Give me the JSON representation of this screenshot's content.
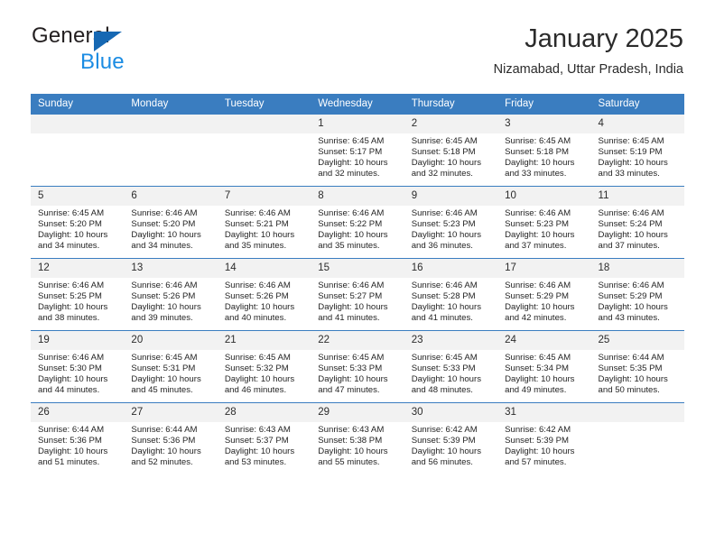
{
  "brand": {
    "name_part1": "General",
    "name_part2": "Blue",
    "logo_icon": "triangle-flag-icon",
    "accent_color": "#1668b3",
    "secondary_color": "#1b8ce3"
  },
  "header": {
    "title": "January 2025",
    "subtitle": "Nizamabad, Uttar Pradesh, India"
  },
  "theme": {
    "header_bar_color": "#3a7dc0",
    "day_number_bg": "#f2f2f2",
    "grid_line_color": "#3a7dc0"
  },
  "weekday_headers": [
    "Sunday",
    "Monday",
    "Tuesday",
    "Wednesday",
    "Thursday",
    "Friday",
    "Saturday"
  ],
  "weeks": [
    [
      {
        "day": "",
        "empty": true,
        "sunrise": "",
        "sunset": "",
        "daylight_line1": "",
        "daylight_line2": ""
      },
      {
        "day": "",
        "empty": true,
        "sunrise": "",
        "sunset": "",
        "daylight_line1": "",
        "daylight_line2": ""
      },
      {
        "day": "",
        "empty": true,
        "sunrise": "",
        "sunset": "",
        "daylight_line1": "",
        "daylight_line2": ""
      },
      {
        "day": "1",
        "sunrise": "Sunrise: 6:45 AM",
        "sunset": "Sunset: 5:17 PM",
        "daylight_line1": "Daylight: 10 hours",
        "daylight_line2": "and 32 minutes."
      },
      {
        "day": "2",
        "sunrise": "Sunrise: 6:45 AM",
        "sunset": "Sunset: 5:18 PM",
        "daylight_line1": "Daylight: 10 hours",
        "daylight_line2": "and 32 minutes."
      },
      {
        "day": "3",
        "sunrise": "Sunrise: 6:45 AM",
        "sunset": "Sunset: 5:18 PM",
        "daylight_line1": "Daylight: 10 hours",
        "daylight_line2": "and 33 minutes."
      },
      {
        "day": "4",
        "sunrise": "Sunrise: 6:45 AM",
        "sunset": "Sunset: 5:19 PM",
        "daylight_line1": "Daylight: 10 hours",
        "daylight_line2": "and 33 minutes."
      }
    ],
    [
      {
        "day": "5",
        "sunrise": "Sunrise: 6:45 AM",
        "sunset": "Sunset: 5:20 PM",
        "daylight_line1": "Daylight: 10 hours",
        "daylight_line2": "and 34 minutes."
      },
      {
        "day": "6",
        "sunrise": "Sunrise: 6:46 AM",
        "sunset": "Sunset: 5:20 PM",
        "daylight_line1": "Daylight: 10 hours",
        "daylight_line2": "and 34 minutes."
      },
      {
        "day": "7",
        "sunrise": "Sunrise: 6:46 AM",
        "sunset": "Sunset: 5:21 PM",
        "daylight_line1": "Daylight: 10 hours",
        "daylight_line2": "and 35 minutes."
      },
      {
        "day": "8",
        "sunrise": "Sunrise: 6:46 AM",
        "sunset": "Sunset: 5:22 PM",
        "daylight_line1": "Daylight: 10 hours",
        "daylight_line2": "and 35 minutes."
      },
      {
        "day": "9",
        "sunrise": "Sunrise: 6:46 AM",
        "sunset": "Sunset: 5:23 PM",
        "daylight_line1": "Daylight: 10 hours",
        "daylight_line2": "and 36 minutes."
      },
      {
        "day": "10",
        "sunrise": "Sunrise: 6:46 AM",
        "sunset": "Sunset: 5:23 PM",
        "daylight_line1": "Daylight: 10 hours",
        "daylight_line2": "and 37 minutes."
      },
      {
        "day": "11",
        "sunrise": "Sunrise: 6:46 AM",
        "sunset": "Sunset: 5:24 PM",
        "daylight_line1": "Daylight: 10 hours",
        "daylight_line2": "and 37 minutes."
      }
    ],
    [
      {
        "day": "12",
        "sunrise": "Sunrise: 6:46 AM",
        "sunset": "Sunset: 5:25 PM",
        "daylight_line1": "Daylight: 10 hours",
        "daylight_line2": "and 38 minutes."
      },
      {
        "day": "13",
        "sunrise": "Sunrise: 6:46 AM",
        "sunset": "Sunset: 5:26 PM",
        "daylight_line1": "Daylight: 10 hours",
        "daylight_line2": "and 39 minutes."
      },
      {
        "day": "14",
        "sunrise": "Sunrise: 6:46 AM",
        "sunset": "Sunset: 5:26 PM",
        "daylight_line1": "Daylight: 10 hours",
        "daylight_line2": "and 40 minutes."
      },
      {
        "day": "15",
        "sunrise": "Sunrise: 6:46 AM",
        "sunset": "Sunset: 5:27 PM",
        "daylight_line1": "Daylight: 10 hours",
        "daylight_line2": "and 41 minutes."
      },
      {
        "day": "16",
        "sunrise": "Sunrise: 6:46 AM",
        "sunset": "Sunset: 5:28 PM",
        "daylight_line1": "Daylight: 10 hours",
        "daylight_line2": "and 41 minutes."
      },
      {
        "day": "17",
        "sunrise": "Sunrise: 6:46 AM",
        "sunset": "Sunset: 5:29 PM",
        "daylight_line1": "Daylight: 10 hours",
        "daylight_line2": "and 42 minutes."
      },
      {
        "day": "18",
        "sunrise": "Sunrise: 6:46 AM",
        "sunset": "Sunset: 5:29 PM",
        "daylight_line1": "Daylight: 10 hours",
        "daylight_line2": "and 43 minutes."
      }
    ],
    [
      {
        "day": "19",
        "sunrise": "Sunrise: 6:46 AM",
        "sunset": "Sunset: 5:30 PM",
        "daylight_line1": "Daylight: 10 hours",
        "daylight_line2": "and 44 minutes."
      },
      {
        "day": "20",
        "sunrise": "Sunrise: 6:45 AM",
        "sunset": "Sunset: 5:31 PM",
        "daylight_line1": "Daylight: 10 hours",
        "daylight_line2": "and 45 minutes."
      },
      {
        "day": "21",
        "sunrise": "Sunrise: 6:45 AM",
        "sunset": "Sunset: 5:32 PM",
        "daylight_line1": "Daylight: 10 hours",
        "daylight_line2": "and 46 minutes."
      },
      {
        "day": "22",
        "sunrise": "Sunrise: 6:45 AM",
        "sunset": "Sunset: 5:33 PM",
        "daylight_line1": "Daylight: 10 hours",
        "daylight_line2": "and 47 minutes."
      },
      {
        "day": "23",
        "sunrise": "Sunrise: 6:45 AM",
        "sunset": "Sunset: 5:33 PM",
        "daylight_line1": "Daylight: 10 hours",
        "daylight_line2": "and 48 minutes."
      },
      {
        "day": "24",
        "sunrise": "Sunrise: 6:45 AM",
        "sunset": "Sunset: 5:34 PM",
        "daylight_line1": "Daylight: 10 hours",
        "daylight_line2": "and 49 minutes."
      },
      {
        "day": "25",
        "sunrise": "Sunrise: 6:44 AM",
        "sunset": "Sunset: 5:35 PM",
        "daylight_line1": "Daylight: 10 hours",
        "daylight_line2": "and 50 minutes."
      }
    ],
    [
      {
        "day": "26",
        "sunrise": "Sunrise: 6:44 AM",
        "sunset": "Sunset: 5:36 PM",
        "daylight_line1": "Daylight: 10 hours",
        "daylight_line2": "and 51 minutes."
      },
      {
        "day": "27",
        "sunrise": "Sunrise: 6:44 AM",
        "sunset": "Sunset: 5:36 PM",
        "daylight_line1": "Daylight: 10 hours",
        "daylight_line2": "and 52 minutes."
      },
      {
        "day": "28",
        "sunrise": "Sunrise: 6:43 AM",
        "sunset": "Sunset: 5:37 PM",
        "daylight_line1": "Daylight: 10 hours",
        "daylight_line2": "and 53 minutes."
      },
      {
        "day": "29",
        "sunrise": "Sunrise: 6:43 AM",
        "sunset": "Sunset: 5:38 PM",
        "daylight_line1": "Daylight: 10 hours",
        "daylight_line2": "and 55 minutes."
      },
      {
        "day": "30",
        "sunrise": "Sunrise: 6:42 AM",
        "sunset": "Sunset: 5:39 PM",
        "daylight_line1": "Daylight: 10 hours",
        "daylight_line2": "and 56 minutes."
      },
      {
        "day": "31",
        "sunrise": "Sunrise: 6:42 AM",
        "sunset": "Sunset: 5:39 PM",
        "daylight_line1": "Daylight: 10 hours",
        "daylight_line2": "and 57 minutes."
      },
      {
        "day": "",
        "empty": true,
        "sunrise": "",
        "sunset": "",
        "daylight_line1": "",
        "daylight_line2": ""
      }
    ]
  ]
}
